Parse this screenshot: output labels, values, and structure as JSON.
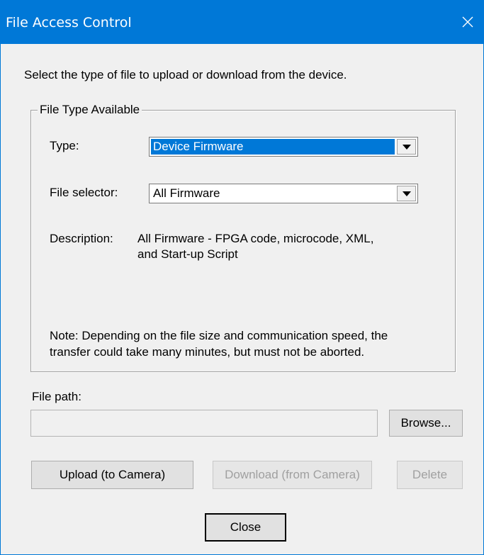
{
  "window": {
    "title": "File Access Control"
  },
  "intro_text": "Select the type of file to upload or download from the device.",
  "group": {
    "legend": "File Type Available",
    "type_label": "Type:",
    "type_value": "Device Firmware",
    "selector_label": "File selector:",
    "selector_value": "All Firmware",
    "description_label": "Description:",
    "description_line1": "All Firmware -  FPGA code, microcode, XML,",
    "description_line2": "and Start-up Script",
    "note_line1": "Note: Depending on the file size and communication speed, the",
    "note_line2": "transfer could take many minutes, but must not be aborted."
  },
  "file_path": {
    "label": "File path:",
    "value": ""
  },
  "buttons": {
    "browse": "Browse...",
    "upload": "Upload (to Camera)",
    "download": "Download (from Camera)",
    "delete": "Delete",
    "close": "Close"
  },
  "colors": {
    "titlebar": "#0078d7",
    "selection": "#0078d7",
    "dialog_bg": "#f0f0f0"
  }
}
